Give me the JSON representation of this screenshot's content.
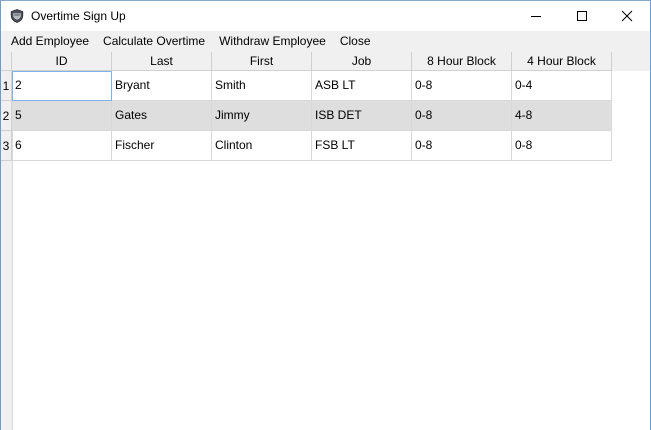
{
  "window": {
    "title": "Overtime Sign Up",
    "icon": "badge-icon"
  },
  "menu": [
    {
      "label": "Add Employee"
    },
    {
      "label": "Calculate Overtime"
    },
    {
      "label": "Withdraw Employee"
    },
    {
      "label": "Close"
    }
  ],
  "table": {
    "columns": [
      "ID",
      "Last",
      "First",
      "Job",
      "8 Hour Block",
      "4 Hour Block"
    ],
    "rows": [
      {
        "num": "1",
        "cells": [
          "2",
          "Bryant",
          "Smith",
          "ASB LT",
          "0-8",
          "0-4"
        ]
      },
      {
        "num": "2",
        "cells": [
          "5",
          "Gates",
          "Jimmy",
          "ISB DET",
          "0-8",
          "4-8"
        ]
      },
      {
        "num": "3",
        "cells": [
          "6",
          "Fischer",
          "Clinton",
          "FSB LT",
          "0-8",
          "0-8"
        ]
      }
    ],
    "selected_cell": {
      "row": 1,
      "column": "ID"
    }
  },
  "colors": {
    "alternate_row": "#dedede",
    "selection_border": "#7eb4ea",
    "header_background": "#f0f0f0"
  }
}
